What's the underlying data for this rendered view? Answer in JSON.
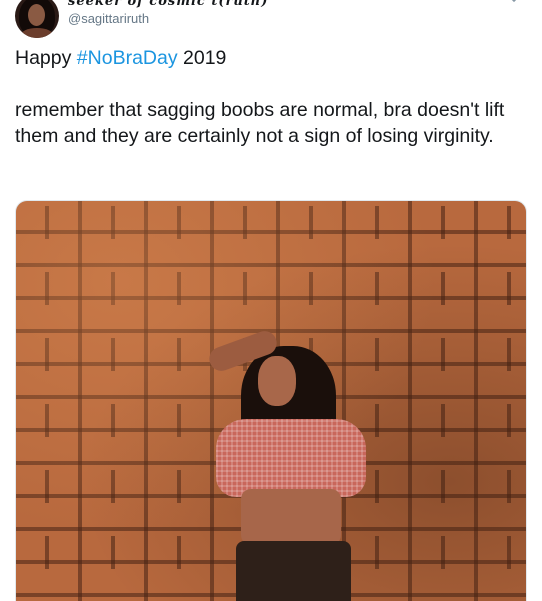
{
  "tweet": {
    "author": {
      "display_name": "seeker of cosmic t(ruth)",
      "handle": "@sagittariruth",
      "avatar_icon": "profile-photo"
    },
    "menu_icon": "chevron-down-icon",
    "text": {
      "line1_prefix": "Happy ",
      "hashtag": "#NoBraDay",
      "line1_suffix": " 2019",
      "body": "remember that sagging boobs are normal, bra doesn't lift them and they are certainly not a sign of losing virginity."
    },
    "media": {
      "type": "photo"
    }
  },
  "colors": {
    "link": "#1b95e0",
    "text": "#14171a",
    "muted": "#657786"
  }
}
